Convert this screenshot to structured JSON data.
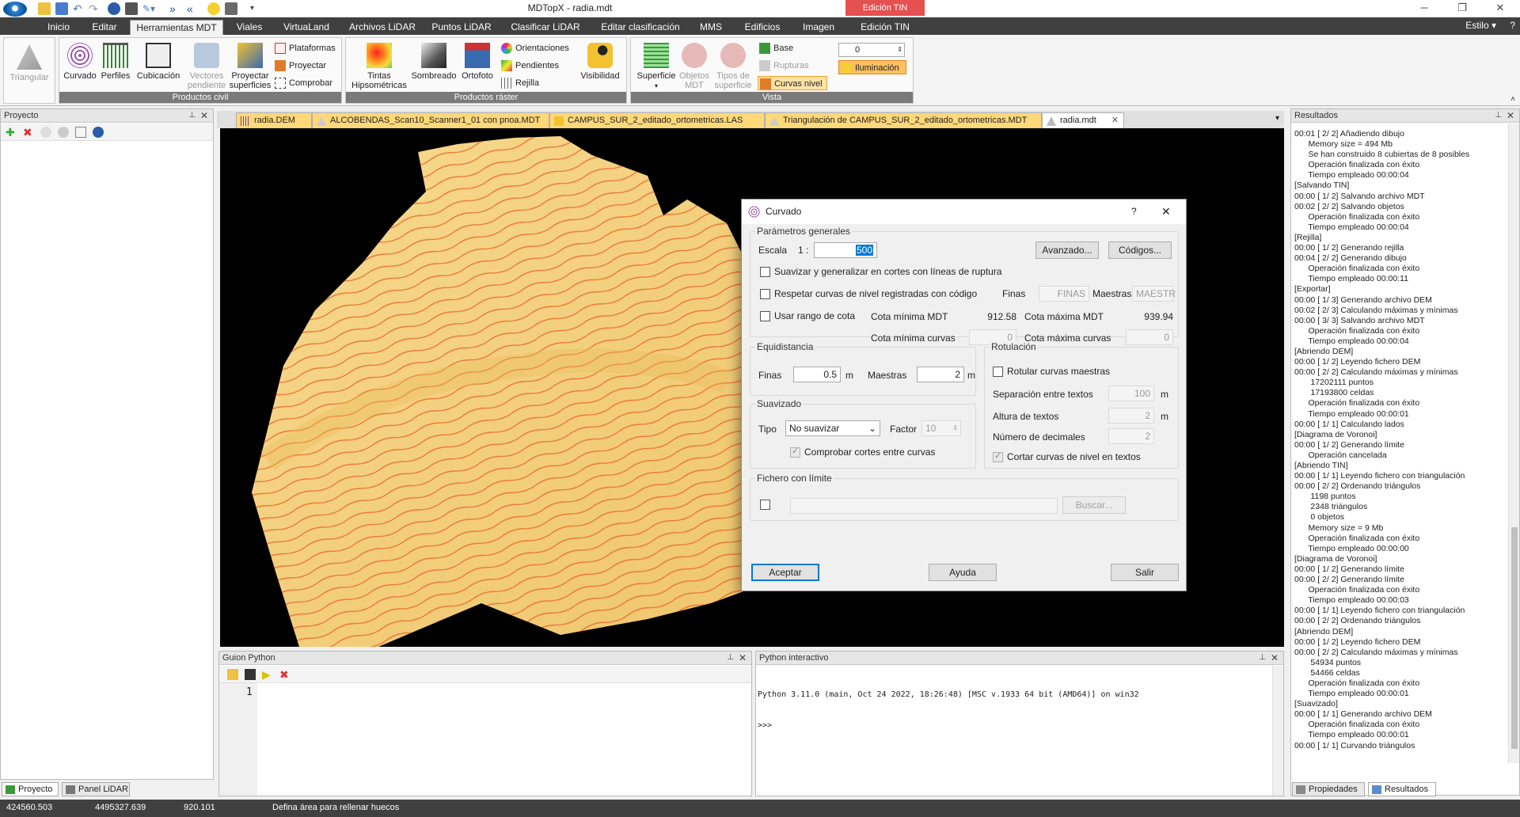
{
  "app": {
    "title": "MDTopX - radia.mdt",
    "context_tab": "Edición TIN",
    "style_label": "Estilo"
  },
  "ribbon_tabs": [
    "Inicio",
    "Editar",
    "Herramientas MDT",
    "Viales",
    "VirtuaLand",
    "Archivos LiDAR",
    "Puntos LiDAR",
    "Clasificar LiDAR",
    "Editar clasificación",
    "MMS",
    "Edificios",
    "Imagen",
    "Edición TIN"
  ],
  "ribbon": {
    "triangular": "Triangular",
    "civil": {
      "label": "Productos civil",
      "curvado": "Curvado",
      "perfiles": "Perfiles",
      "cubicacion": "Cubicación",
      "vectores": "Vectores pendiente",
      "proyectar_sup": "Proyectar superficies",
      "plataformas": "Plataformas",
      "proyectar": "Proyectar",
      "comprobar": "Comprobar"
    },
    "raster": {
      "label": "Productos ráster",
      "tintas": "Tintas Hipsométricas",
      "sombreado": "Sombreado",
      "ortofoto": "Ortofoto",
      "orientaciones": "Orientaciones",
      "pendientes": "Pendientes",
      "rejilla": "Rejilla",
      "visibilidad": "Visibilidad"
    },
    "vista": {
      "label": "Vista",
      "superficie": "Superficie",
      "objetos": "Objetos MDT",
      "tipos": "Tipos de superficie",
      "base": "Base",
      "rupturas": "Rupturas",
      "curvas_nivel": "Curvas nivel",
      "spin_value": "0",
      "iluminacion": "Iluminación"
    }
  },
  "panels": {
    "proyecto": "Proyecto",
    "guion": "Guion Python",
    "interactivo": "Python interactivo",
    "resultados": "Resultados"
  },
  "bottom_tabs": {
    "proyecto": "Proyecto",
    "panel_lidar": "Panel LiDAR",
    "propiedades": "Propiedades",
    "resultados": "Resultados"
  },
  "doc_tabs": [
    "radia.DEM",
    "ALCOBENDAS_Scan10_Scanner1_01 con pnoa.MDT",
    "CAMPUS_SUR_2_editado_ortometricas.LAS",
    "Triangulación de CAMPUS_SUR_2_editado_ortometricas.MDT",
    "radia.mdt"
  ],
  "dialog": {
    "title": "Curvado",
    "help": "?",
    "generales": {
      "legend": "Parámetros generales",
      "escala": "Escala",
      "escala_prefix": "1 :",
      "escala_value": "500",
      "avanzado": "Avanzado...",
      "codigos": "Códigos...",
      "suavizar": "Suavizar y generalizar en cortes con líneas de ruptura",
      "respetar": "Respetar curvas de nivel registradas con código",
      "finas": "Finas",
      "finas_ph": "FINAS",
      "maestras": "Maestras",
      "maestras_ph": "MAESTR",
      "usar_rango": "Usar rango de cota",
      "cota_min_mdt": "Cota mínima MDT",
      "cota_min_mdt_val": "912.58",
      "cota_max_mdt": "Cota máxima MDT",
      "cota_max_mdt_val": "939.94",
      "cota_min_curvas": "Cota mínima curvas",
      "cota_min_curvas_val": "0",
      "cota_max_curvas": "Cota máxima curvas",
      "cota_max_curvas_val": "0"
    },
    "equidistancia": {
      "legend": "Equidistancia",
      "finas": "Finas",
      "finas_val": "0.5",
      "maestras": "Maestras",
      "maestras_val": "2",
      "unit": "m"
    },
    "rotulacion": {
      "legend": "Rotulación",
      "rotular": "Rotular curvas maestras",
      "separacion": "Separación entre textos",
      "separacion_val": "100",
      "altura": "Altura de textos",
      "altura_val": "2",
      "decimales": "Número de decimales",
      "decimales_val": "2",
      "cortar": "Cortar curvas de nivel en textos",
      "unit": "m"
    },
    "suavizado": {
      "legend": "Suavizado",
      "tipo": "Tipo",
      "tipo_val": "No suavizar",
      "factor": "Factor",
      "factor_val": "10",
      "comprobar": "Comprobar cortes entre curvas"
    },
    "limite": {
      "legend": "Fichero con límite",
      "buscar": "Buscar..."
    },
    "aceptar": "Aceptar",
    "ayuda": "Ayuda",
    "salir": "Salir"
  },
  "python": {
    "gutter": "1",
    "banner": "Python 3.11.0 (main, Oct 24 2022, 18:26:48) [MSC v.1933 64 bit (AMD64)] on win32",
    "prompt": ">>>"
  },
  "results_text": "00:01 [ 2/ 2] Añadiendo dibujo\n      Memory size = 494 Mb\n      Se han construido 8 cubiertas de 8 posibles\n      Operación finalizada con éxito\n      Tiempo empleado 00:00:04\n[Salvando TIN]\n00:00 [ 1/ 2] Salvando archivo MDT\n00:02 [ 2/ 2] Salvando objetos\n      Operación finalizada con éxito\n      Tiempo empleado 00:00:04\n[Rejilla]\n00:00 [ 1/ 2] Generando rejilla\n00:04 [ 2/ 2] Generando dibujo\n      Operación finalizada con éxito\n      Tiempo empleado 00:00:11\n[Exportar]\n00:00 [ 1/ 3] Generando archivo DEM\n00:02 [ 2/ 3] Calculando máximas y mínimas\n00:00 [ 3/ 3] Salvando archivo MDT\n      Operación finalizada con éxito\n      Tiempo empleado 00:00:04\n[Abriendo DEM]\n00:00 [ 1/ 2] Leyendo fichero DEM\n00:00 [ 2/ 2] Calculando máximas y mínimas\n       17202111 puntos\n       17193800 celdas\n      Operación finalizada con éxito\n      Tiempo empleado 00:00:01\n00:00 [ 1/ 1] Calculando lados\n[Diagrama de Voronoi]\n00:00 [ 1/ 2] Generando límite\n      Operación cancelada\n[Abriendo TIN]\n00:00 [ 1/ 1] Leyendo fichero con triangulación\n00:00 [ 2/ 2] Ordenando triángulos\n       1198 puntos\n       2348 triángulos\n       0 objetos\n      Memory size = 9 Mb\n      Operación finalizada con éxito\n      Tiempo empleado 00:00:00\n[Diagrama de Voronoi]\n00:00 [ 1/ 2] Generando límite\n00:00 [ 2/ 2] Generando límite\n      Operación finalizada con éxito\n      Tiempo empleado 00:00:03\n00:00 [ 1/ 1] Leyendo fichero con triangulación\n00:00 [ 2/ 2] Ordenando triángulos\n[Abriendo DEM]\n00:00 [ 1/ 2] Leyendo fichero DEM\n00:00 [ 2/ 2] Calculando máximas y mínimas\n       54934 puntos\n       54466 celdas\n      Operación finalizada con éxito\n      Tiempo empleado 00:00:01\n[Suavizado]\n00:00 [ 1/ 1] Generando archivo DEM\n      Operación finalizada con éxito\n      Tiempo empleado 00:00:01\n00:00 [ 1/ 1] Curvando triángulos",
  "status": {
    "x": "424560.503",
    "y": "4495327.639",
    "z": "920.101",
    "message": "Defina área para rellenar huecos"
  },
  "colors": {
    "terrain": "#f5d585",
    "contour": "#e86a2c",
    "dark_bar": "#404040",
    "context_red": "#e55050"
  }
}
